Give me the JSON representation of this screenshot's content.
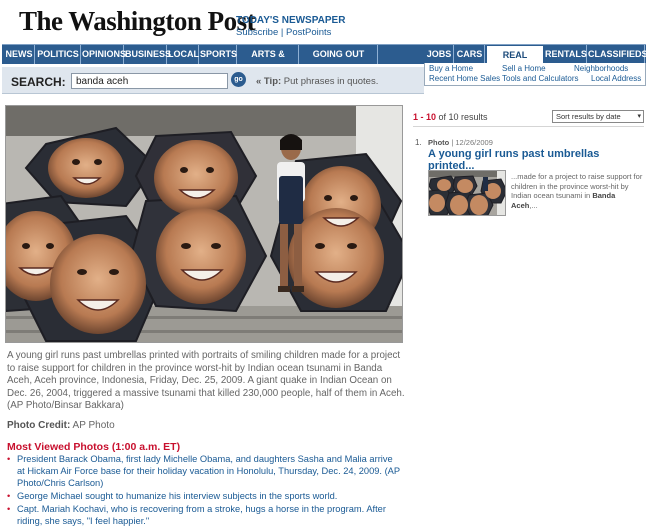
{
  "header": {
    "logo": "The Washington Post",
    "todays_newspaper": "TODAY'S NEWSPAPER",
    "subscribe": "Subscribe",
    "separator": " | ",
    "postpoints": "PostPoints"
  },
  "nav": {
    "items": [
      "NEWS",
      "POLITICS",
      "OPINIONS",
      "BUSINESS",
      "LOCAL",
      "SPORTS",
      "ARTS & LIVING",
      "GOING OUT GUIDE",
      "JOBS",
      "CARS",
      "REAL ESTATE",
      "RENTALS",
      "CLASSIFIEDS"
    ],
    "active": "REAL ESTATE"
  },
  "subnav": {
    "buy_home": "Buy a Home",
    "recent_sales": "Recent Home Sales",
    "sell_home": "Sell a Home",
    "tools": "Tools and Calculators",
    "neighborhoods": "Neighborhoods",
    "local_address": "Local Address"
  },
  "search": {
    "label": "SEARCH:",
    "value": "banda aceh",
    "go": "go",
    "tip_marker": "« Tip:",
    "tip_text": " Put phrases in quotes."
  },
  "photo": {
    "caption": "A young girl runs past umbrellas printed with portraits of smiling children made for a project to raise support for children in the province worst-hit by Indian ocean tsunami in Banda Aceh, Aceh province, Indonesia, Friday, Dec. 25, 2009. A giant quake in Indian Ocean on Dec. 26, 2004, triggered a massive tsunami that killed 230,000 people, half of them in Aceh. (AP Photo/Binsar Bakkara)",
    "credit_label": "Photo Credit:",
    "credit_value": " AP Photo"
  },
  "most_viewed": {
    "title": "Most Viewed Photos (1:00 a.m. ET)",
    "items": [
      "President Barack Obama, first lady Michelle Obama, and daughters Sasha and Malia arrive at Hickam Air Force base for their holiday vacation in Honolulu, Thursday, Dec. 24, 2009. (AP Photo/Chris Carlson)",
      "George Michael sought to humanize his interview subjects in the sports world.",
      "Capt. Mariah Kochavi, who is recovering from a stroke, hugs a horse in the program. After riding, she says, \"I feel happier.\""
    ]
  },
  "results": {
    "range": "1 - 10",
    "of_text": " of 10 results",
    "sort_label": "Sort results by date",
    "item": {
      "number": "1.",
      "type": "Photo",
      "date": " | 12/26/2009",
      "title": "A young girl runs past umbrellas printed...",
      "snippet_pre": "...made for a project to raise support for children in the province worst-hit by Indian ocean tsunami in ",
      "snippet_bold": "Banda Aceh",
      "snippet_post": ",..."
    }
  },
  "colors": {
    "nav_blue": "#2c5c8f",
    "link_blue": "#1a5a94",
    "accent_red": "#c8102e"
  }
}
